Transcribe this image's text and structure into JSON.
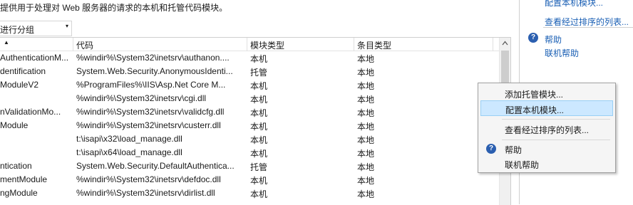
{
  "description": "提供用于处理对 Web 服务器的请求的本机和托管代码模块。",
  "groupby": {
    "label": "进行分组",
    "arrow": "▾"
  },
  "grid": {
    "sort_icon": "▲",
    "headers": [
      "代码",
      "模块类型",
      "条目类型"
    ],
    "rows": [
      [
        "AuthenticationM...",
        "%windir%\\System32\\inetsrv\\authanon....",
        "本机",
        "本地"
      ],
      [
        "dentification",
        "System.Web.Security.AnonymousIdenti...",
        "托管",
        "本地"
      ],
      [
        "ModuleV2",
        "%ProgramFiles%\\IIS\\Asp.Net Core M...",
        "本机",
        "本地"
      ],
      [
        "",
        "%windir%\\System32\\inetsrv\\cgi.dll",
        "本机",
        "本地"
      ],
      [
        "nValidationMo...",
        "%windir%\\System32\\inetsrv\\validcfg.dll",
        "本机",
        "本地"
      ],
      [
        "Module",
        "%windir%\\System32\\inetsrv\\custerr.dll",
        "本机",
        "本地"
      ],
      [
        "",
        "t:\\isapi\\x32\\load_manage.dll",
        "本机",
        "本地"
      ],
      [
        "",
        "t:\\isapi\\x64\\load_manage.dll",
        "本机",
        "本地"
      ],
      [
        "ntication",
        "System.Web.Security.DefaultAuthentica...",
        "托管",
        "本地"
      ],
      [
        "mentModule",
        "%windir%\\System32\\inetsrv\\defdoc.dll",
        "本机",
        "本地"
      ],
      [
        "ngModule",
        "%windir%\\System32\\inetsrv\\dirlist.dll",
        "本机",
        "本地"
      ]
    ]
  },
  "actions": {
    "configure_native": "配置本机模块...",
    "view_ordered": "查看经过排序的列表...",
    "help": "帮助",
    "online_help": "联机帮助",
    "help_icon": "?"
  },
  "context_menu": {
    "items": [
      "添加托管模块...",
      "配置本机模块...",
      "查看经过排序的列表...",
      "帮助",
      "联机帮助"
    ],
    "selected_index": 1,
    "help_icon": "?"
  }
}
